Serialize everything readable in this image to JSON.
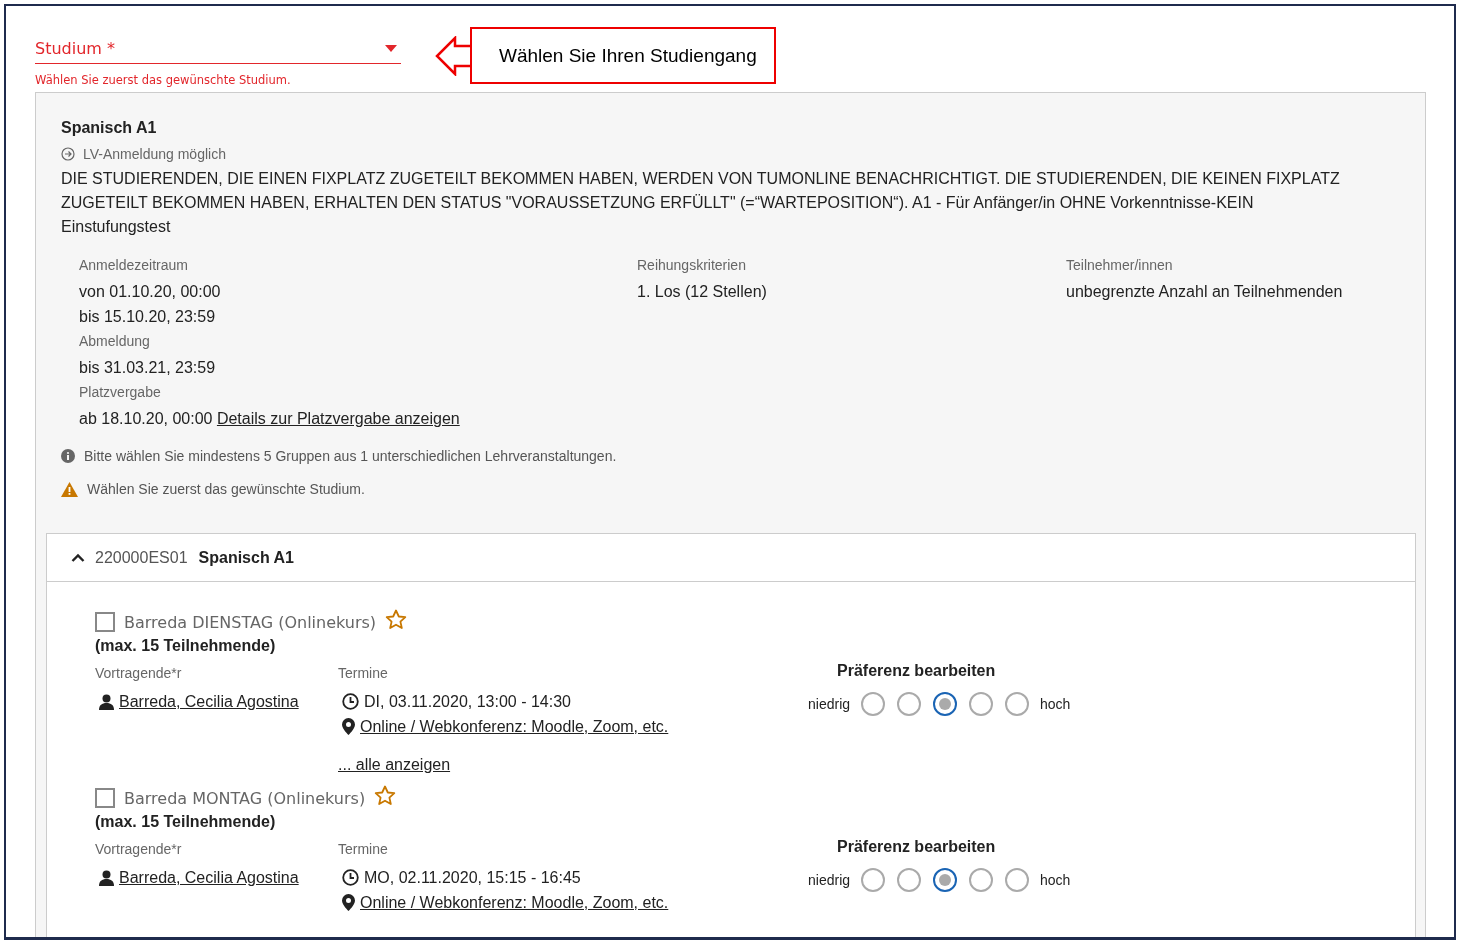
{
  "field": {
    "label": "Studium *",
    "error": "Wählen Sie zuerst das gewünschte Studium.",
    "invalid": true
  },
  "callout": {
    "text": "Wählen Sie Ihren Studiengang"
  },
  "course": {
    "title": "Spanisch A1",
    "status": "LV-Anmeldung möglich",
    "description": "DIE STUDIERENDEN, DIE EINEN FIXPLATZ ZUGETEILT BEKOMMEN HABEN, WERDEN VON TUMONLINE BENACHRICHTIGT. DIE STUDIERENDEN, DIE KEINEN FIXPLATZ ZUGETEILT BEKOMMEN HABEN, ERHALTEN DEN STATUS \"VORAUSSETZUNG ERFÜLLT\" (=“WARTEPOSITION“). A1 - Für Anfänger/in OHNE Vorkenntnisse-KEIN Einstufungstest",
    "columns": [
      {
        "items": [
          {
            "label": "Anmeldezeitraum",
            "lines": [
              "von 01.10.20, 00:00",
              "bis 15.10.20, 23:59"
            ]
          },
          {
            "label": "Abmeldung",
            "lines": [
              "bis 31.03.21, 23:59"
            ]
          },
          {
            "label": "Platzvergabe",
            "lines": [
              "ab 18.10.20, 00:00"
            ],
            "link": "Details zur Platzvergabe anzeigen"
          }
        ]
      },
      {
        "items": [
          {
            "label": "Reihungskriterien",
            "lines": [
              "1. Los (12 Stellen)"
            ]
          }
        ]
      },
      {
        "items": [
          {
            "label": "Teilnehmer/innen",
            "lines": [
              "unbegrenzte Anzahl an Teilnehmenden"
            ]
          }
        ]
      }
    ],
    "notes": [
      {
        "kind": "info",
        "text": "Bitte wählen Sie mindestens 5 Gruppen aus 1 unterschiedlichen Lehrveranstaltungen."
      },
      {
        "kind": "warning",
        "text": "Wählen Sie zuerst das gewünschte Studium."
      }
    ]
  },
  "section": {
    "code": "220000ES01",
    "title": "Spanisch A1",
    "expanded": true,
    "groups": [
      {
        "name": "Barreda DIENSTAG (Onlinekurs)",
        "checked": false,
        "favorite": false,
        "capacity": "(max. 15 Teilnehmende)",
        "lecturer_label": "Vortragende*r",
        "lecturer": "Barreda, Cecilia Agostina",
        "dates_label": "Termine",
        "date": "DI, 03.11.2020, 13:00 - 14:30",
        "location": "Online / Webkonferenz: Moodle, Zoom, etc.",
        "more": "... alle anzeigen",
        "preference": {
          "title": "Präferenz bearbeiten",
          "low": "niedrig",
          "high": "hoch",
          "options": [
            {
              "selected": false
            },
            {
              "selected": false
            },
            {
              "selected": true
            },
            {
              "selected": false
            },
            {
              "selected": false
            }
          ]
        }
      },
      {
        "name": "Barreda MONTAG (Onlinekurs)",
        "checked": false,
        "favorite": false,
        "capacity": "(max. 15 Teilnehmende)",
        "lecturer_label": "Vortragende*r",
        "lecturer": "Barreda, Cecilia Agostina",
        "dates_label": "Termine",
        "date": "MO, 02.11.2020, 15:15 - 16:45",
        "location": "Online / Webkonferenz: Moodle, Zoom, etc.",
        "preference": {
          "title": "Präferenz bearbeiten",
          "low": "niedrig",
          "high": "hoch",
          "options": [
            {
              "selected": false
            },
            {
              "selected": false
            },
            {
              "selected": true
            },
            {
              "selected": false
            },
            {
              "selected": false
            }
          ]
        }
      }
    ]
  }
}
